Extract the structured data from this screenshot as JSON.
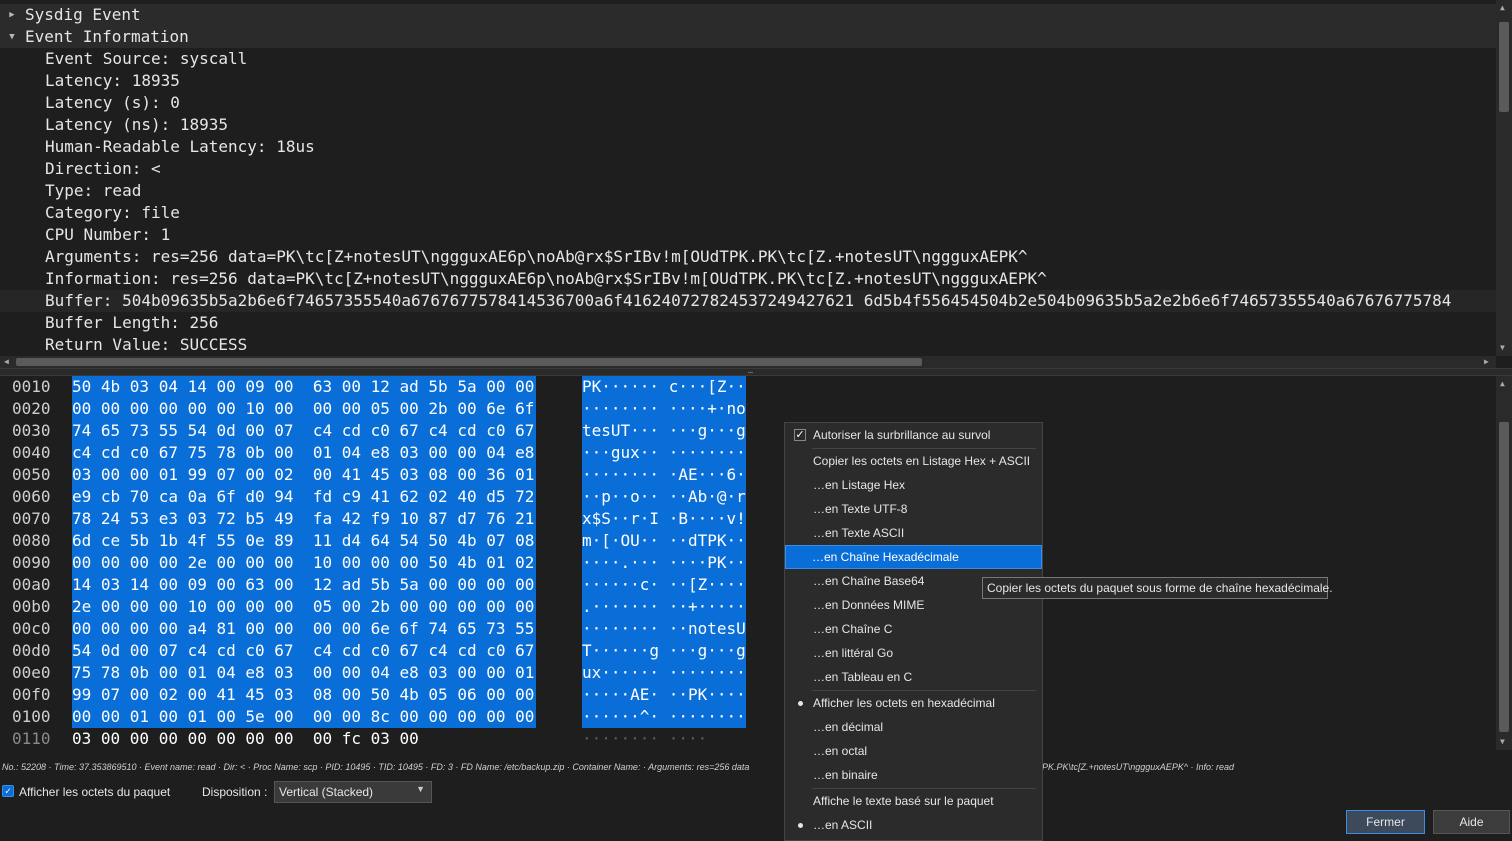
{
  "tree": {
    "nodes": [
      {
        "label": "Sysdig Event",
        "expanded": false
      },
      {
        "label": "Event Information",
        "expanded": true
      }
    ],
    "fields": [
      "Event Source: syscall",
      "Latency: 18935",
      "Latency (s): 0",
      "Latency (ns): 18935",
      "Human-Readable Latency: 18us",
      "Direction: <",
      "Type: read",
      "Category: file",
      "CPU Number: 1",
      "Arguments: res=256 data=PK\\tc[Z+notesUT\\nggguxAE6p\\noAb@rx$SrIBv!m[OUdTPK.PK\\tc[Z.+notesUT\\nggguxAEPK^",
      "Information: res=256 data=PK\\tc[Z+notesUT\\nggguxAE6p\\noAb@rx$SrIBv!m[OUdTPK.PK\\tc[Z.+notesUT\\nggguxAEPK^",
      "Buffer: 504b09635b5a2b6e6f74657355540a6767677578414536700a6f416240727824537249427621 6d5b4f556454504b2e504b09635b5a2e2b6e6f74657355540a67676775784",
      "Buffer Length: 256",
      "Return Value: SUCCESS"
    ]
  },
  "hex": {
    "rows": [
      {
        "offset": "0010",
        "bytes": "50 4b 03 04 14 00 09 00  63 00 12 ad 5b 5a 00 00",
        "ascii": "PK······ c···[Z··",
        "selected": true
      },
      {
        "offset": "0020",
        "bytes": "00 00 00 00 00 00 10 00  00 00 05 00 2b 00 6e 6f",
        "ascii": "········ ····+·no",
        "selected": true
      },
      {
        "offset": "0030",
        "bytes": "74 65 73 55 54 0d 00 07  c4 cd c0 67 c4 cd c0 67",
        "ascii": "tesUT··· ···g···g",
        "selected": true
      },
      {
        "offset": "0040",
        "bytes": "c4 cd c0 67 75 78 0b 00  01 04 e8 03 00 00 04 e8",
        "ascii": "···gux·· ········",
        "selected": true
      },
      {
        "offset": "0050",
        "bytes": "03 00 00 01 99 07 00 02  00 41 45 03 08 00 36 01",
        "ascii": "········ ·AE···6·",
        "selected": true
      },
      {
        "offset": "0060",
        "bytes": "e9 cb 70 ca 0a 6f d0 94  fd c9 41 62 02 40 d5 72",
        "ascii": "··p··o·· ··Ab·@·r",
        "selected": true
      },
      {
        "offset": "0070",
        "bytes": "78 24 53 e3 03 72 b5 49  fa 42 f9 10 87 d7 76 21",
        "ascii": "x$S··r·I ·B····v!",
        "selected": true
      },
      {
        "offset": "0080",
        "bytes": "6d ce 5b 1b 4f 55 0e 89  11 d4 64 54 50 4b 07 08",
        "ascii": "m·[·OU·· ··dTPK··",
        "selected": true
      },
      {
        "offset": "0090",
        "bytes": "00 00 00 00 2e 00 00 00  10 00 00 00 50 4b 01 02",
        "ascii": "····.··· ····PK··",
        "selected": true
      },
      {
        "offset": "00a0",
        "bytes": "14 03 14 00 09 00 63 00  12 ad 5b 5a 00 00 00 00",
        "ascii": "······c· ··[Z····",
        "selected": true
      },
      {
        "offset": "00b0",
        "bytes": "2e 00 00 00 10 00 00 00  05 00 2b 00 00 00 00 00",
        "ascii": ".······· ··+·····",
        "selected": true
      },
      {
        "offset": "00c0",
        "bytes": "00 00 00 00 a4 81 00 00  00 00 6e 6f 74 65 73 55",
        "ascii": "········ ··notesU",
        "selected": true
      },
      {
        "offset": "00d0",
        "bytes": "54 0d 00 07 c4 cd c0 67  c4 cd c0 67 c4 cd c0 67",
        "ascii": "T······g ···g···g",
        "selected": true
      },
      {
        "offset": "00e0",
        "bytes": "75 78 0b 00 01 04 e8 03  00 00 04 e8 03 00 00 01",
        "ascii": "ux······ ········",
        "selected": true
      },
      {
        "offset": "00f0",
        "bytes": "99 07 00 02 00 41 45 03  08 00 50 4b 05 06 00 00",
        "ascii": "·····AE· ··PK····",
        "selected": true
      },
      {
        "offset": "0100",
        "bytes": "00 00 01 00 01 00 5e 00  00 00 8c 00 00 00 00 00",
        "ascii": "······^· ········",
        "selected": true
      },
      {
        "offset": "0110",
        "bytes": "03 00 00 00 00 00 00 00  00 fc 03 00",
        "ascii": "········ ····",
        "selected": false
      }
    ]
  },
  "status": {
    "left": "No.: 52208 · Time: 37.353869510 · Event name: read · Dir: < · Proc Name: scp · PID: 10495 · TID: 10495 · FD: 3 · FD Name: /etc/backup.zip · Container Name: · Arguments: res=256 data",
    "right": "PK.PK\\tc[Z.+notesUT\\nggguxAEPK^ · Info: read"
  },
  "bottom": {
    "show_bytes_label": "Afficher les octets du paquet",
    "layout_label": "Disposition :",
    "layout_value": "Vertical (Stacked)",
    "close_label": "Fermer",
    "help_label": "Aide"
  },
  "menu": {
    "items": [
      {
        "label": "Autoriser la surbrillance au survol",
        "mark": "check"
      },
      {
        "label": "Copier les octets en Listage Hex + ASCII",
        "mark": ""
      },
      {
        "label": "…en Listage Hex",
        "mark": ""
      },
      {
        "label": "…en Texte UTF-8",
        "mark": ""
      },
      {
        "label": "…en Texte ASCII",
        "mark": ""
      },
      {
        "label": "…en Chaîne Hexadécimale",
        "mark": "",
        "highlighted": true
      },
      {
        "label": "…en Chaîne Base64",
        "mark": ""
      },
      {
        "label": "…en Données MIME",
        "mark": ""
      },
      {
        "label": "…en Chaîne C",
        "mark": ""
      },
      {
        "label": "…en littéral Go",
        "mark": ""
      },
      {
        "label": "…en Tableau en C",
        "mark": ""
      },
      {
        "label": "Afficher les octets en hexadécimal",
        "mark": "dot"
      },
      {
        "label": "…en décimal",
        "mark": ""
      },
      {
        "label": "…en octal",
        "mark": ""
      },
      {
        "label": "…en binaire",
        "mark": ""
      },
      {
        "label": "Affiche le texte basé sur le paquet",
        "mark": ""
      },
      {
        "label": "…en ASCII",
        "mark": "dot"
      }
    ],
    "tooltip": "Copier les octets du paquet sous forme de chaîne hexadécimale."
  }
}
